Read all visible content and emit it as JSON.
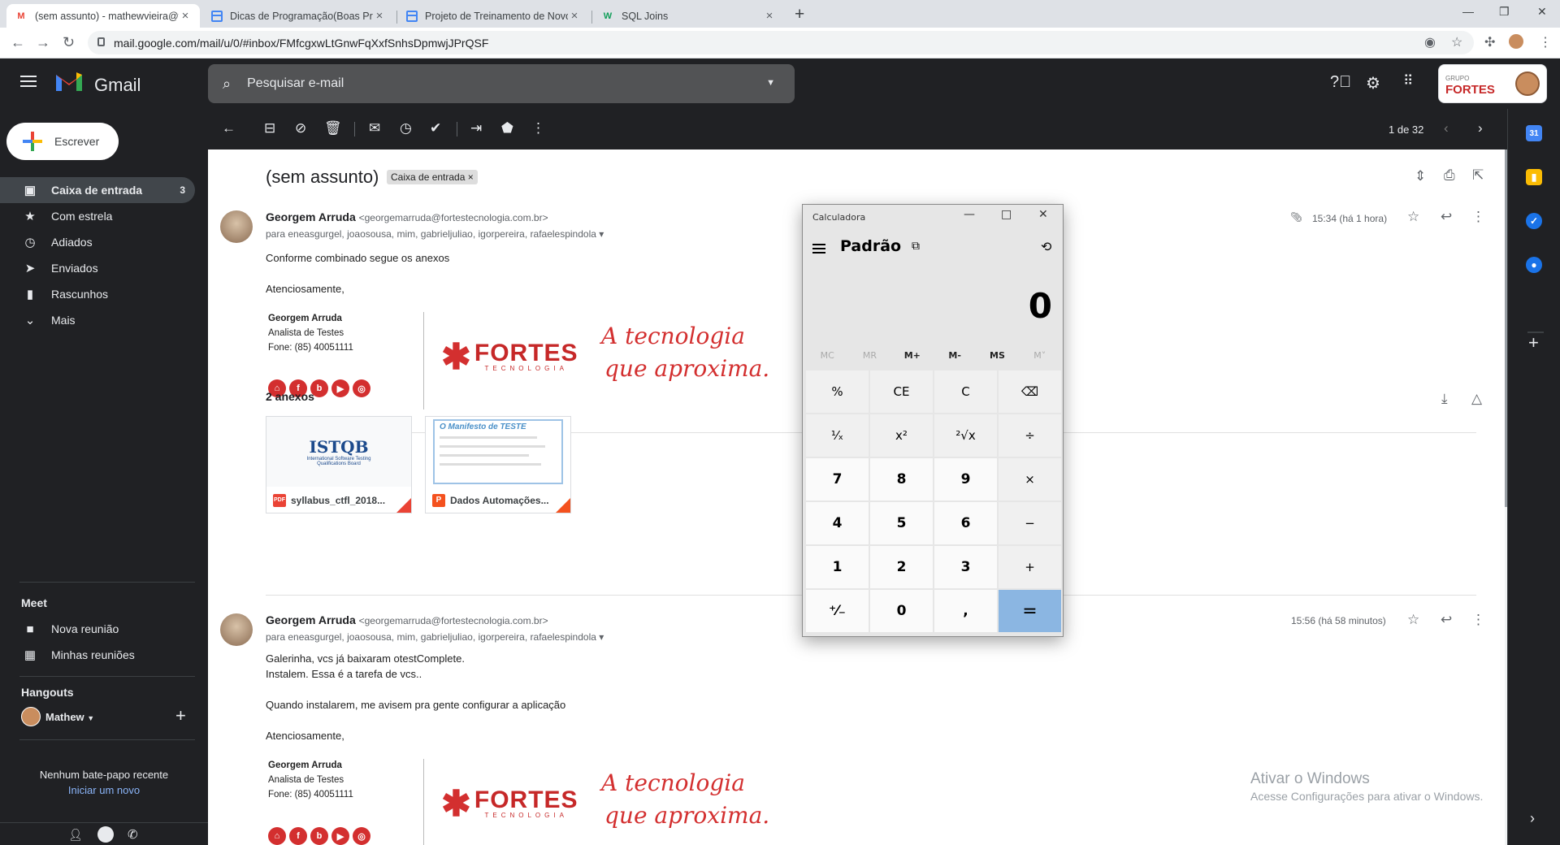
{
  "browser": {
    "tabs": [
      {
        "title": "(sem assunto) - mathewvieira@fortestecnologia.com.br",
        "favicon": "gmail-icon",
        "active": true
      },
      {
        "title": "Dicas de Programação(Boas Práticas)",
        "favicon": "docs-icon",
        "active": false
      },
      {
        "title": "Projeto de Treinamento de Novos",
        "favicon": "docs-icon",
        "active": false
      },
      {
        "title": "SQL Joins",
        "favicon": "w-icon",
        "active": false
      }
    ],
    "url": "mail.google.com/mail/u/0/#inbox/FMfcgxwLtGnwFqXxfSnhsDpmwjJPrQSF"
  },
  "gmail": {
    "app_name": "Gmail",
    "search_placeholder": "Pesquisar e-mail",
    "account_org": "FORTES",
    "account_org_small": "GRUPO",
    "compose_label": "Escrever",
    "nav": [
      {
        "label": "Caixa de entrada",
        "count": "3",
        "icon": "inbox-icon",
        "selected": true
      },
      {
        "label": "Com estrela",
        "count": "",
        "icon": "star-icon",
        "selected": false
      },
      {
        "label": "Adiados",
        "count": "",
        "icon": "clock-icon",
        "selected": false
      },
      {
        "label": "Enviados",
        "count": "",
        "icon": "send-icon",
        "selected": false
      },
      {
        "label": "Rascunhos",
        "count": "",
        "icon": "draft-icon",
        "selected": false
      },
      {
        "label": "Mais",
        "count": "",
        "icon": "chevron-down-icon",
        "selected": false
      }
    ],
    "meet": {
      "title": "Meet",
      "items": [
        "Nova reunião",
        "Minhas reuniões"
      ]
    },
    "hangouts": {
      "title": "Hangouts",
      "user": "Mathew",
      "no_chats": "Nenhum bate-papo recente",
      "start_new": "Iniciar um novo"
    },
    "pagination": "1 de 32"
  },
  "thread": {
    "subject": "(sem assunto)",
    "label": "Caixa de entrada",
    "messages": [
      {
        "sender": "Georgem Arruda",
        "email": "<georgemarruda@fortestecnologia.com.br>",
        "recipients": "para eneasgurgel, joaosousa, mim, gabrieljuliao, igorpereira, rafaelespindola",
        "time": "15:34 (há 1 hora)",
        "body": [
          "Conforme combinado segue os anexos",
          "",
          "Atenciosamente,"
        ]
      },
      {
        "sender": "Georgem Arruda",
        "email": "<georgemarruda@fortestecnologia.com.br>",
        "recipients": "para eneasgurgel, joaosousa, mim, gabrieljuliao, igorpereira, rafaelespindola",
        "time": "15:56 (há 58 minutos)",
        "body": [
          "Galerinha, vcs já baixaram otestComplete.",
          "Instalem. Essa é a tarefa de vcs..",
          "",
          "Quando instalarem, me avisem pra gente configurar a aplicação",
          "",
          "Atenciosamente,"
        ]
      }
    ],
    "signature": {
      "name": "Georgem Arruda",
      "role": "Analista de Testes",
      "phone": "Fone: (85) 40051111",
      "brand": "FORTES",
      "brand_sub": "TECNOLOGIA",
      "slogan_line1": "A tecnologia",
      "slogan_line2": "que aproxima."
    },
    "attachments_title": "2 anexos",
    "attachments": [
      {
        "name": "syllabus_ctfl_2018...",
        "type": "PDF",
        "color": "#ea4335",
        "thumb_text": "ISTQB",
        "thumb_sub": "International Software Testing Qualifications Board"
      },
      {
        "name": "Dados Automações...",
        "type": "P",
        "color": "#f4511e",
        "thumb_text": "O Manifesto de TESTE",
        "thumb_sub": ""
      }
    ]
  },
  "calculator": {
    "title": "Calculadora",
    "mode": "Padrão",
    "display": "0",
    "memory": [
      "MC",
      "MR",
      "M+",
      "M-",
      "MS",
      "M˅"
    ],
    "keys": [
      "%",
      "CE",
      "C",
      "⌫",
      "¹⁄ₓ",
      "x²",
      "²√x",
      "÷",
      "7",
      "8",
      "9",
      "×",
      "4",
      "5",
      "6",
      "−",
      "1",
      "2",
      "3",
      "+",
      "⁺⁄₋",
      "0",
      ",",
      "="
    ]
  },
  "watermark": {
    "line1": "Ativar o Windows",
    "line2": "Acesse Configurações para ativar o Windows."
  }
}
